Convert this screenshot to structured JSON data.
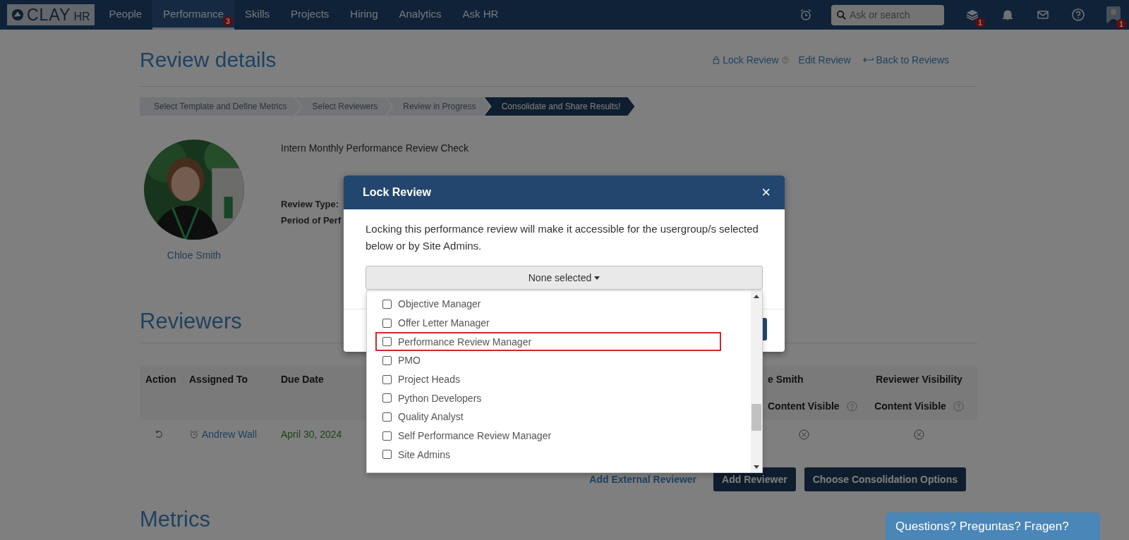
{
  "nav": {
    "logo": "CLAY",
    "logo_suffix": "HR",
    "items": [
      {
        "label": "People",
        "selected": false
      },
      {
        "label": "Performance",
        "selected": true,
        "badge": "3"
      },
      {
        "label": "Skills",
        "selected": false
      },
      {
        "label": "Projects",
        "selected": false
      },
      {
        "label": "Hiring",
        "selected": false
      },
      {
        "label": "Analytics",
        "selected": false
      },
      {
        "label": "Ask HR",
        "selected": false
      }
    ],
    "search": {
      "placeholder": "Ask or search"
    },
    "stack_badge": "1",
    "avatar_badge": "1"
  },
  "page": {
    "title": "Review details",
    "actions": [
      "Lock Review",
      "Edit Review",
      "Back to Reviews"
    ],
    "steps": [
      {
        "label": "Select Template and Define Metrics",
        "selected": false
      },
      {
        "label": "Select Reviewers",
        "selected": false
      },
      {
        "label": "Review in Progress",
        "selected": false
      },
      {
        "label": "Consolidate and Share Results!",
        "selected": true
      }
    ],
    "review_name": "Intern Monthly Performance Review Check",
    "employee_name": "Chloe Smith",
    "fields": [
      "Review Type:",
      "Period of Perf"
    ]
  },
  "reviewers": {
    "title": "Reviewers",
    "columns": [
      "Action",
      "Assigned To",
      "Due Date"
    ],
    "columns_right": [
      "e Smith",
      "Reviewer Visibility"
    ],
    "subheaders": [
      "Content Visible",
      "Content Visible"
    ],
    "rows": [
      {
        "assigned_to": "Andrew Wall",
        "due_date": "April 30, 2024"
      }
    ],
    "link": "Add External Reviewer",
    "buttons": [
      "Add Reviewer",
      "Choose Consolidation Options"
    ]
  },
  "metrics_title": "Metrics",
  "modal": {
    "title": "Lock Review",
    "close": "×",
    "message": "Locking this performance review will make it accessible for the usergroup/s selected below or by Site Admins.",
    "dropdown": "None selected",
    "options": [
      {
        "label": "Objective Manager",
        "checked": false,
        "highlighted": false
      },
      {
        "label": "Offer Letter Manager",
        "checked": false,
        "highlighted": false
      },
      {
        "label": "Performance Review Manager",
        "checked": false,
        "highlighted": true
      },
      {
        "label": "PMO",
        "checked": false,
        "highlighted": false
      },
      {
        "label": "Project Heads",
        "checked": false,
        "highlighted": false
      },
      {
        "label": "Python Developers",
        "checked": false,
        "highlighted": false
      },
      {
        "label": "Quality Analyst",
        "checked": false,
        "highlighted": false
      },
      {
        "label": "Self Performance Review Manager",
        "checked": false,
        "highlighted": false
      },
      {
        "label": "Site Admins",
        "checked": false,
        "highlighted": false
      }
    ]
  },
  "chat": "Questions? Preguntas? Fragen?"
}
